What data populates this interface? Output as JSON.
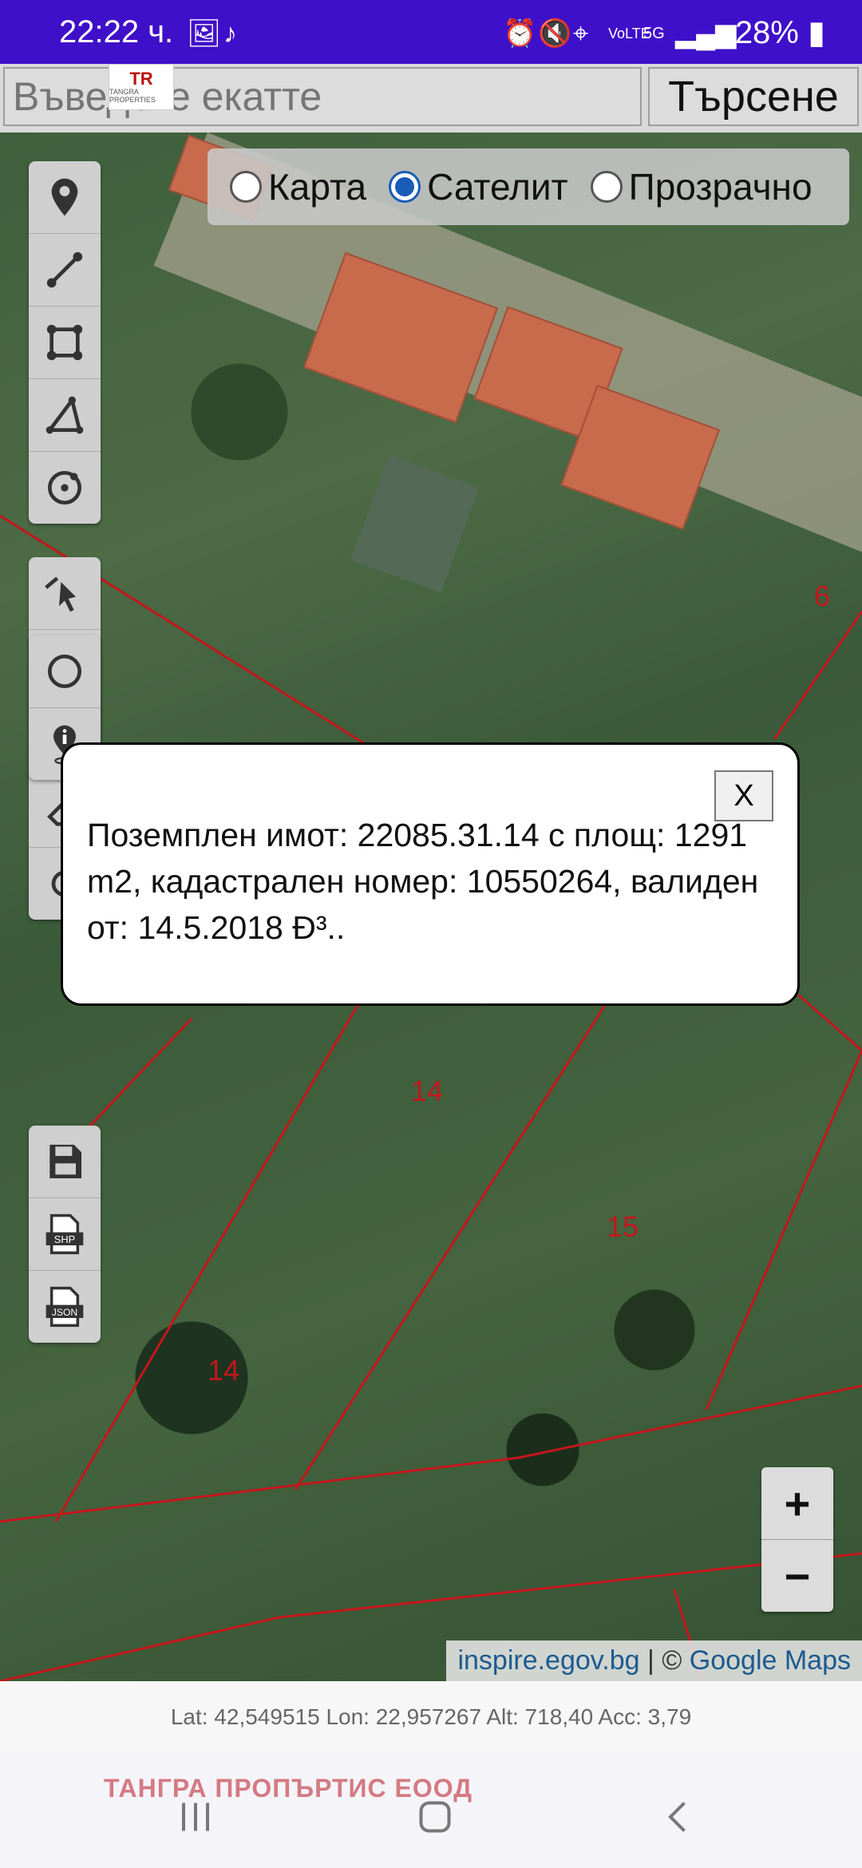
{
  "status_bar": {
    "time": "22:22 ч.",
    "battery": "28%",
    "icons": [
      "image-icon",
      "tiktok-icon",
      "alarm-icon",
      "mute-icon",
      "location-icon",
      "volte-icon",
      "5g-icon",
      "signal-icon",
      "battery-icon"
    ]
  },
  "search": {
    "placeholder": "Въведете екатте",
    "button_label": "Търсене"
  },
  "logo": {
    "mark": "TR",
    "text": "TANGRA PROPERTIES"
  },
  "map_type": {
    "options": [
      {
        "label": "Карта",
        "selected": false
      },
      {
        "label": "Сателит",
        "selected": true
      },
      {
        "label": "Прозрачно",
        "selected": false
      }
    ]
  },
  "parcel_labels": [
    "6",
    "14",
    "15",
    "14"
  ],
  "tools": {
    "draw": [
      "marker-icon",
      "line-icon",
      "polygon-icon",
      "angle-icon",
      "circle-icon"
    ],
    "edit": [
      "select-icon",
      "move-icon",
      "cut-icon",
      "erase-icon",
      "undo-icon"
    ],
    "info": [
      "circle-tool-icon",
      "info-pin-icon"
    ],
    "export": [
      "save-icon",
      "shp-file-icon",
      "json-file-icon"
    ],
    "shp_label": "SHP",
    "json_label": "JSON"
  },
  "popup": {
    "close_label": "X",
    "text": "Поземплен имот: 22085.31.14 с площ: 1291 m2, кадастрален номер: 10550264, валиден от: 14.5.2018 Ð³.."
  },
  "zoom": {
    "in": "+",
    "out": "−"
  },
  "attribution": {
    "source": "inspire.egov.bg",
    "sep": " | © ",
    "provider": "Google Maps"
  },
  "coordinates": "Lat: 42,549515 Lon: 22,957267 Alt: 718,40 Acc: 3,79",
  "watermark": "ТАНГРА ПРОПЪРТИС  ЕООД",
  "colors": {
    "status_bar": "#3f10c9",
    "parcel_line": "#c4161c",
    "radio_selected": "#1a5bb5"
  }
}
